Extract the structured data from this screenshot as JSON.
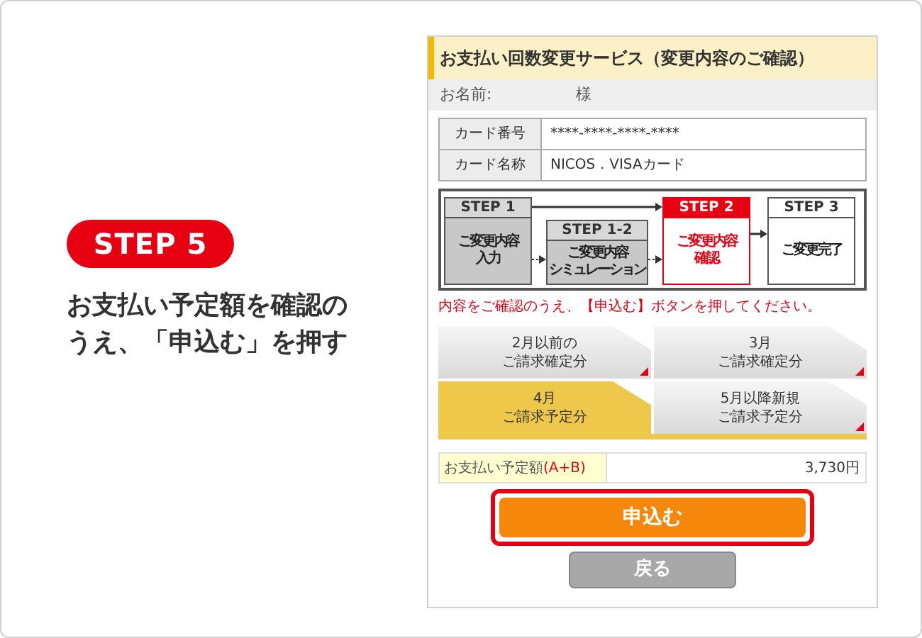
{
  "guide": {
    "step_badge": "STEP 5",
    "instruction_lines": [
      "お支払い予定額を確認の",
      "うえ、「申込む」を押す"
    ]
  },
  "screen": {
    "title": "お支払い回数変更サービス（変更内容のご確認）",
    "name_label": "お名前:",
    "name_suffix": "様",
    "card_table": [
      {
        "label": "カード番号",
        "value": "****-****-****-****"
      },
      {
        "label": "カード名称",
        "value": "NICOS．VISAカード"
      }
    ],
    "steps": [
      {
        "label": "STEP 1",
        "lines": [
          "ご変更内容",
          "入力"
        ],
        "completed": true,
        "current": false
      },
      {
        "label": "STEP 1-2",
        "lines": [
          "ご変更内容",
          "シミュレーション"
        ],
        "completed": true,
        "current": false
      },
      {
        "label": "STEP 2",
        "lines": [
          "ご変更内容",
          "確認"
        ],
        "completed": false,
        "current": true
      },
      {
        "label": "STEP 3",
        "lines": [
          "ご変更完了"
        ],
        "completed": false,
        "current": false
      }
    ],
    "note": "内容をご確認のうえ、【申込む】ボタンを押してください。",
    "tabs": [
      {
        "lines": [
          "2月以前の",
          "ご請求確定分"
        ],
        "selected": false
      },
      {
        "lines": [
          "3月",
          "ご請求確定分"
        ],
        "selected": false
      },
      {
        "lines": [
          "4月",
          "ご請求予定分"
        ],
        "selected": true
      },
      {
        "lines": [
          "5月以降新規",
          "ご請求予定分"
        ],
        "selected": false
      }
    ],
    "total": {
      "label": "お支払い予定額",
      "label_suffix": "(A+B)",
      "value": "3,730円"
    },
    "buttons": [
      {
        "label": "申込む",
        "kind": "primary",
        "highlighted": true
      },
      {
        "label": "戻る",
        "kind": "secondary",
        "highlighted": false
      }
    ]
  }
}
